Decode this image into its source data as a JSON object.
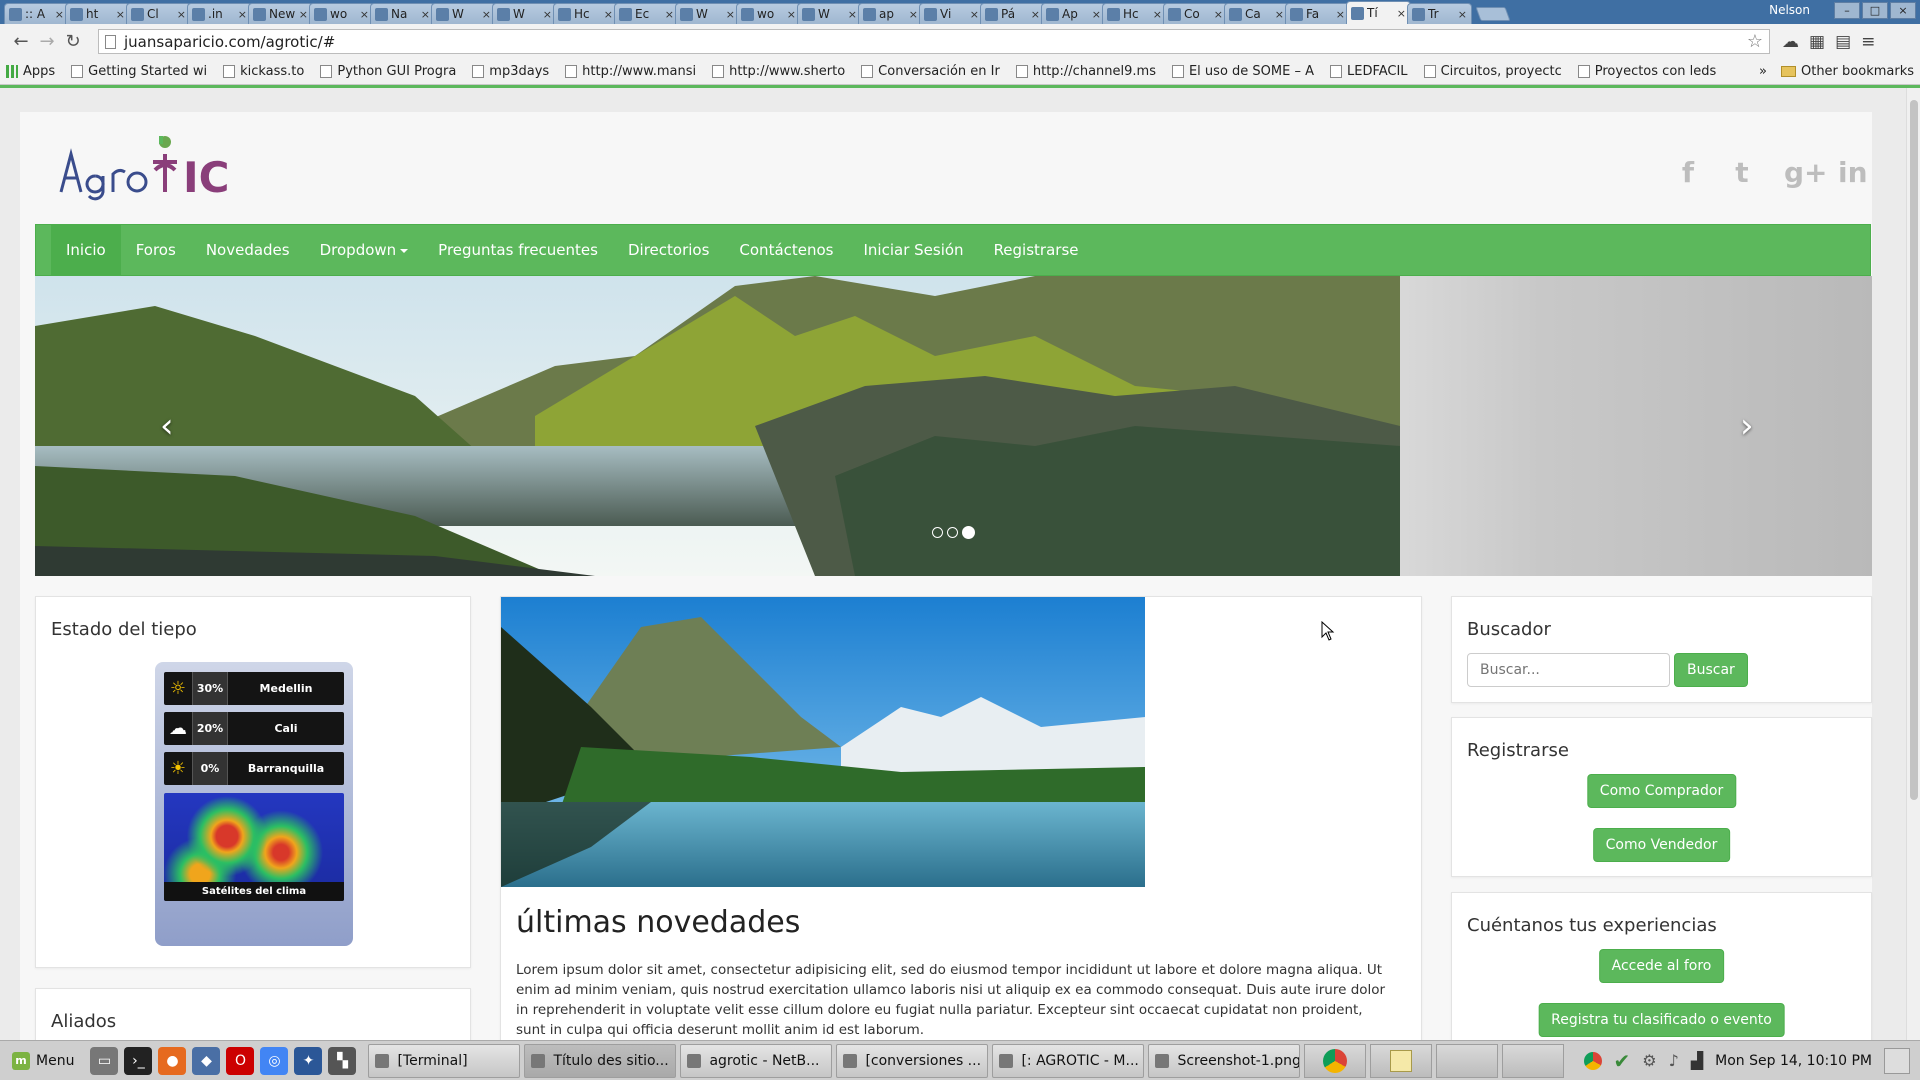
{
  "browser": {
    "tabs": [
      {
        "title": ":: A",
        "active": false
      },
      {
        "title": "ht",
        "active": false
      },
      {
        "title": "Cl",
        "active": false
      },
      {
        "title": ".in",
        "active": false
      },
      {
        "title": "New",
        "active": false
      },
      {
        "title": "wo",
        "active": false
      },
      {
        "title": "Na",
        "active": false
      },
      {
        "title": "W",
        "active": false
      },
      {
        "title": "W",
        "active": false
      },
      {
        "title": "Hc",
        "active": false
      },
      {
        "title": "Ec",
        "active": false
      },
      {
        "title": "W",
        "active": false
      },
      {
        "title": "wo",
        "active": false
      },
      {
        "title": "W",
        "active": false
      },
      {
        "title": "ap",
        "active": false
      },
      {
        "title": "Vi",
        "active": false
      },
      {
        "title": "Pá",
        "active": false
      },
      {
        "title": "Ap",
        "active": false
      },
      {
        "title": "Hc",
        "active": false
      },
      {
        "title": "Co",
        "active": false
      },
      {
        "title": "Ca",
        "active": false
      },
      {
        "title": "Fa",
        "active": false
      },
      {
        "title": "Tí",
        "active": true
      },
      {
        "title": "Tr",
        "active": false
      }
    ],
    "tab_close": "×",
    "user": "Nelson",
    "url": "juansaparicio.com/agrotic/#",
    "bookmarks": [
      "Apps",
      "Getting Started wi",
      "kickass.to",
      "Python GUI Progra",
      "mp3days",
      "http://www.mansi",
      "http://www.sherto",
      "Conversación en Ir",
      "http://channel9.ms",
      "El uso de SOME – A",
      "LEDFACIL",
      "Circuitos, proyectc",
      "Proyectos con leds"
    ],
    "bookmarks_more": "»",
    "other_bookmarks": "Other bookmarks"
  },
  "site": {
    "logo_text": "AgroTIC",
    "social": [
      "f",
      "t",
      "g+",
      "in"
    ],
    "nav": {
      "items": [
        "Inicio",
        "Foros",
        "Novedades",
        "Dropdown",
        "Preguntas frecuentes",
        "Directorios",
        "Contáctenos",
        "Iniciar Sesión",
        "Registrarse"
      ],
      "active": "Inicio"
    },
    "carousel": {
      "prev": "‹",
      "next": "›",
      "slides": 3,
      "active_slide": 3
    },
    "weather": {
      "title": "Estado del tiepo",
      "rows": [
        {
          "pct": "30%",
          "city": "Medellin",
          "icon": "☼"
        },
        {
          "pct": "20%",
          "city": "Cali",
          "icon": "☁"
        },
        {
          "pct": "0%",
          "city": "Barranquilla",
          "icon": "☀"
        }
      ],
      "satellite_label": "Satélites del clima"
    },
    "aliados": {
      "title": "Aliados"
    },
    "main": {
      "title": "últimas novedades",
      "text": "Lorem ipsum dolor sit amet, consectetur adipisicing elit, sed do eiusmod tempor incididunt ut labore et dolore magna aliqua. Ut enim ad minim veniam, quis nostrud exercitation ullamco laboris nisi ut aliquip ex ea commodo consequat. Duis aute irure dolor in reprehenderit in voluptate velit esse cillum dolore eu fugiat nulla pariatur. Excepteur sint occaecat cupidatat non proident, sunt in culpa qui officia deserunt mollit anim id est laborum."
    },
    "buscador": {
      "title": "Buscador",
      "placeholder": "Buscar...",
      "button": "Buscar"
    },
    "registrarse": {
      "title": "Registrarse",
      "comprador": "Como Comprador",
      "vendedor": "Como Vendedor"
    },
    "experiencias": {
      "title": "Cuéntanos tus experiencias",
      "foro": "Accede al foro",
      "clasificado": "Registra tu clasificado o evento"
    }
  },
  "taskbar": {
    "menu": "Menu",
    "tasks": [
      {
        "label": "[Terminal]",
        "active": false
      },
      {
        "label": "Título des sitio...",
        "active": true
      },
      {
        "label": "agrotic - NetB...",
        "active": false
      },
      {
        "label": "[conversiones ...",
        "active": false
      },
      {
        "label": "[: AGROTIC - M...",
        "active": false
      },
      {
        "label": "Screenshot-1.png",
        "active": false
      }
    ],
    "clock": "Mon Sep 14, 10:10 PM"
  },
  "colors": {
    "brand_green": "#5cb85c",
    "brand_green_dark": "#4cae4c",
    "tabstrip": "#3f6fa3"
  }
}
